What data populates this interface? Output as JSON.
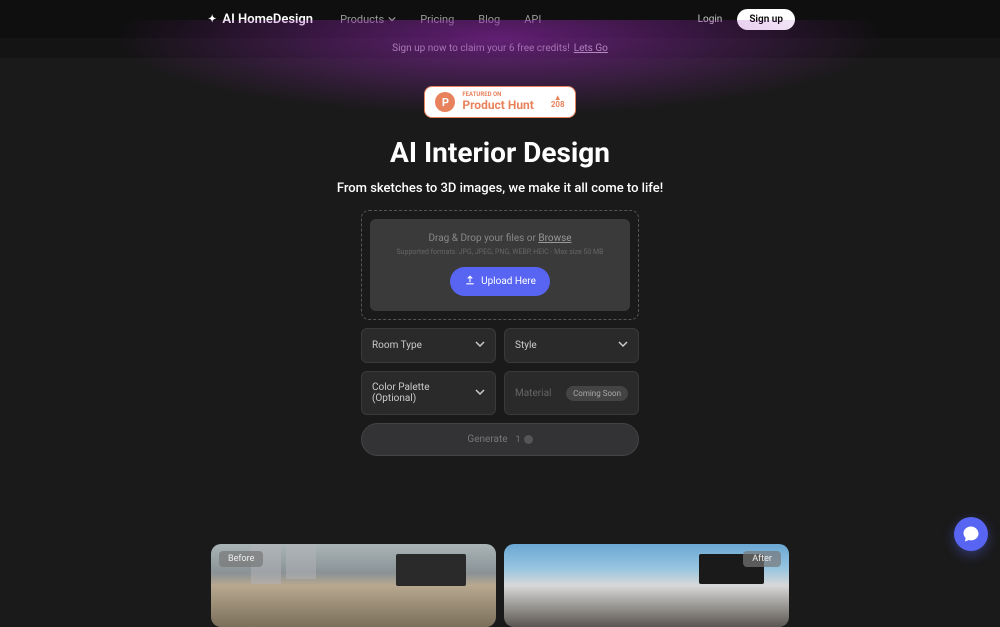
{
  "header": {
    "logo": "AI HomeDesign",
    "nav": {
      "products": "Products",
      "pricing": "Pricing",
      "blog": "Blog",
      "api": "API"
    },
    "login": "Login",
    "signup": "Sign up"
  },
  "announcement": {
    "text": "Sign up now to claim your 6 free credits!",
    "link": "Lets Go"
  },
  "producthunt": {
    "featured": "FEATURED ON",
    "name": "Product Hunt",
    "count": "208"
  },
  "hero": {
    "title": "AI Interior Design",
    "subtitle": "From sketches to 3D images, we make it all come to life!"
  },
  "upload": {
    "drag_text": "Drag & Drop your files or ",
    "browse": "Browse",
    "supported": "Supported formats: JPG, JPEG, PNG, WEBP, HEIC - Max size 50 MB",
    "button": "Upload Here"
  },
  "options": {
    "room_type": "Room Type",
    "style": "Style",
    "color_palette": "Color Palette (Optional)",
    "material": "Material",
    "coming_soon": "Coming Soon"
  },
  "generate": {
    "label": "Generate",
    "credits": "1"
  },
  "gallery": {
    "before": "Before",
    "after": "After"
  }
}
